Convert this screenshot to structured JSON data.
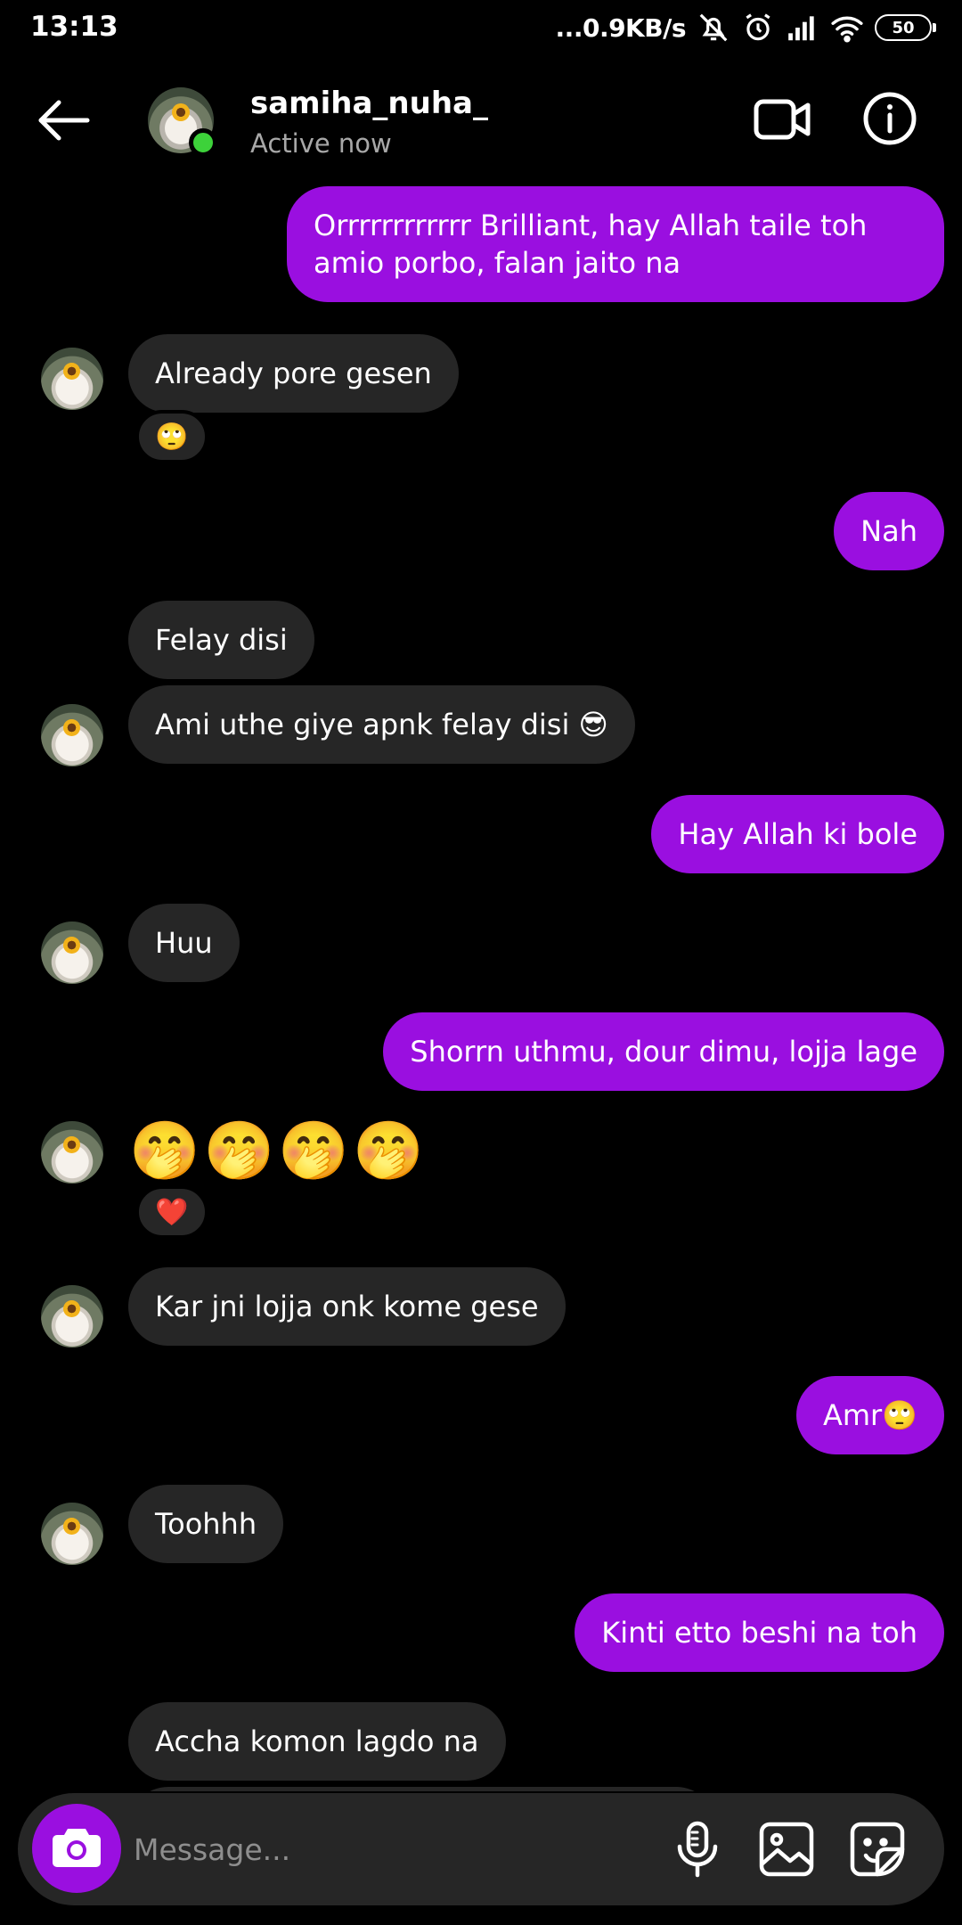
{
  "status_bar": {
    "time": "13:13",
    "net_speed": "...0.9KB/s",
    "battery": "50",
    "icons": [
      "mute-icon",
      "alarm-icon",
      "signal-icon",
      "wifi-icon",
      "battery-icon"
    ]
  },
  "header": {
    "name": "samiha_nuha_",
    "status": "Active now",
    "icons": [
      "back-arrow-icon",
      "video-call-icon",
      "info-icon"
    ]
  },
  "messages": [
    {
      "dir": "out",
      "text": "Orrrrrrrrrrrr Brilliant, hay Allah taile toh amio porbo, falan jaito na"
    },
    {
      "dir": "in",
      "text": "Already pore gesen",
      "reaction": "🙄"
    },
    {
      "dir": "out",
      "text": "Nah"
    },
    {
      "dir": "in",
      "text": "Felay disi"
    },
    {
      "dir": "in",
      "text": "Ami uthe giye apnk felay disi 😎"
    },
    {
      "dir": "out",
      "text": "Hay Allah ki bole"
    },
    {
      "dir": "in",
      "text": "Huu"
    },
    {
      "dir": "out",
      "text": "Shorrn uthmu, dour dimu, lojja lage"
    },
    {
      "dir": "in",
      "text": "🤭🤭🤭🤭",
      "reaction": "❤️"
    },
    {
      "dir": "in",
      "text": "Kar jni lojja onk kome gese"
    },
    {
      "dir": "out",
      "text": "Amr🙄"
    },
    {
      "dir": "in",
      "text": "Toohhh"
    },
    {
      "dir": "out",
      "text": "Kinti etto beshi na toh"
    },
    {
      "dir": "in",
      "text": "Accha komon lagdo na"
    }
  ],
  "composer": {
    "placeholder": "Message...",
    "icons": [
      "camera-icon",
      "microphone-icon",
      "gallery-icon",
      "sticker-icon"
    ]
  },
  "colors": {
    "outgoing_bubble": "#9a0fe0",
    "incoming_bubble": "#262626",
    "background": "#000000",
    "online": "#3dd23a"
  }
}
